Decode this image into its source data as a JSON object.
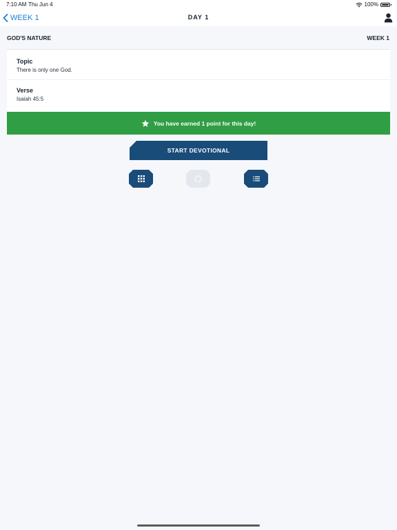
{
  "status_bar": {
    "time": "7:10 AM",
    "date": "Thu Jun 4",
    "battery": "100%"
  },
  "nav": {
    "back_label": "WEEK 1",
    "title": "DAY 1"
  },
  "section": {
    "left": "GOD'S NATURE",
    "right": "WEEK 1"
  },
  "details": {
    "topic_label": "Topic",
    "topic_value": "There is only one God.",
    "verse_label": "Verse",
    "verse_value": "Isaiah 45:5"
  },
  "banner": {
    "text": "You have earned 1 point for this day!"
  },
  "actions": {
    "start_label": "START DEVOTIONAL"
  },
  "colors": {
    "accent": "#1a7fd6",
    "primary": "#194c78",
    "success": "#2f9e44",
    "background": "#f5f7fb"
  },
  "icons": {
    "back": "chevron-left-icon",
    "profile": "person-icon",
    "star": "star-icon",
    "grid": "grid-icon",
    "disabled": "circle-icon",
    "list": "list-icon"
  }
}
